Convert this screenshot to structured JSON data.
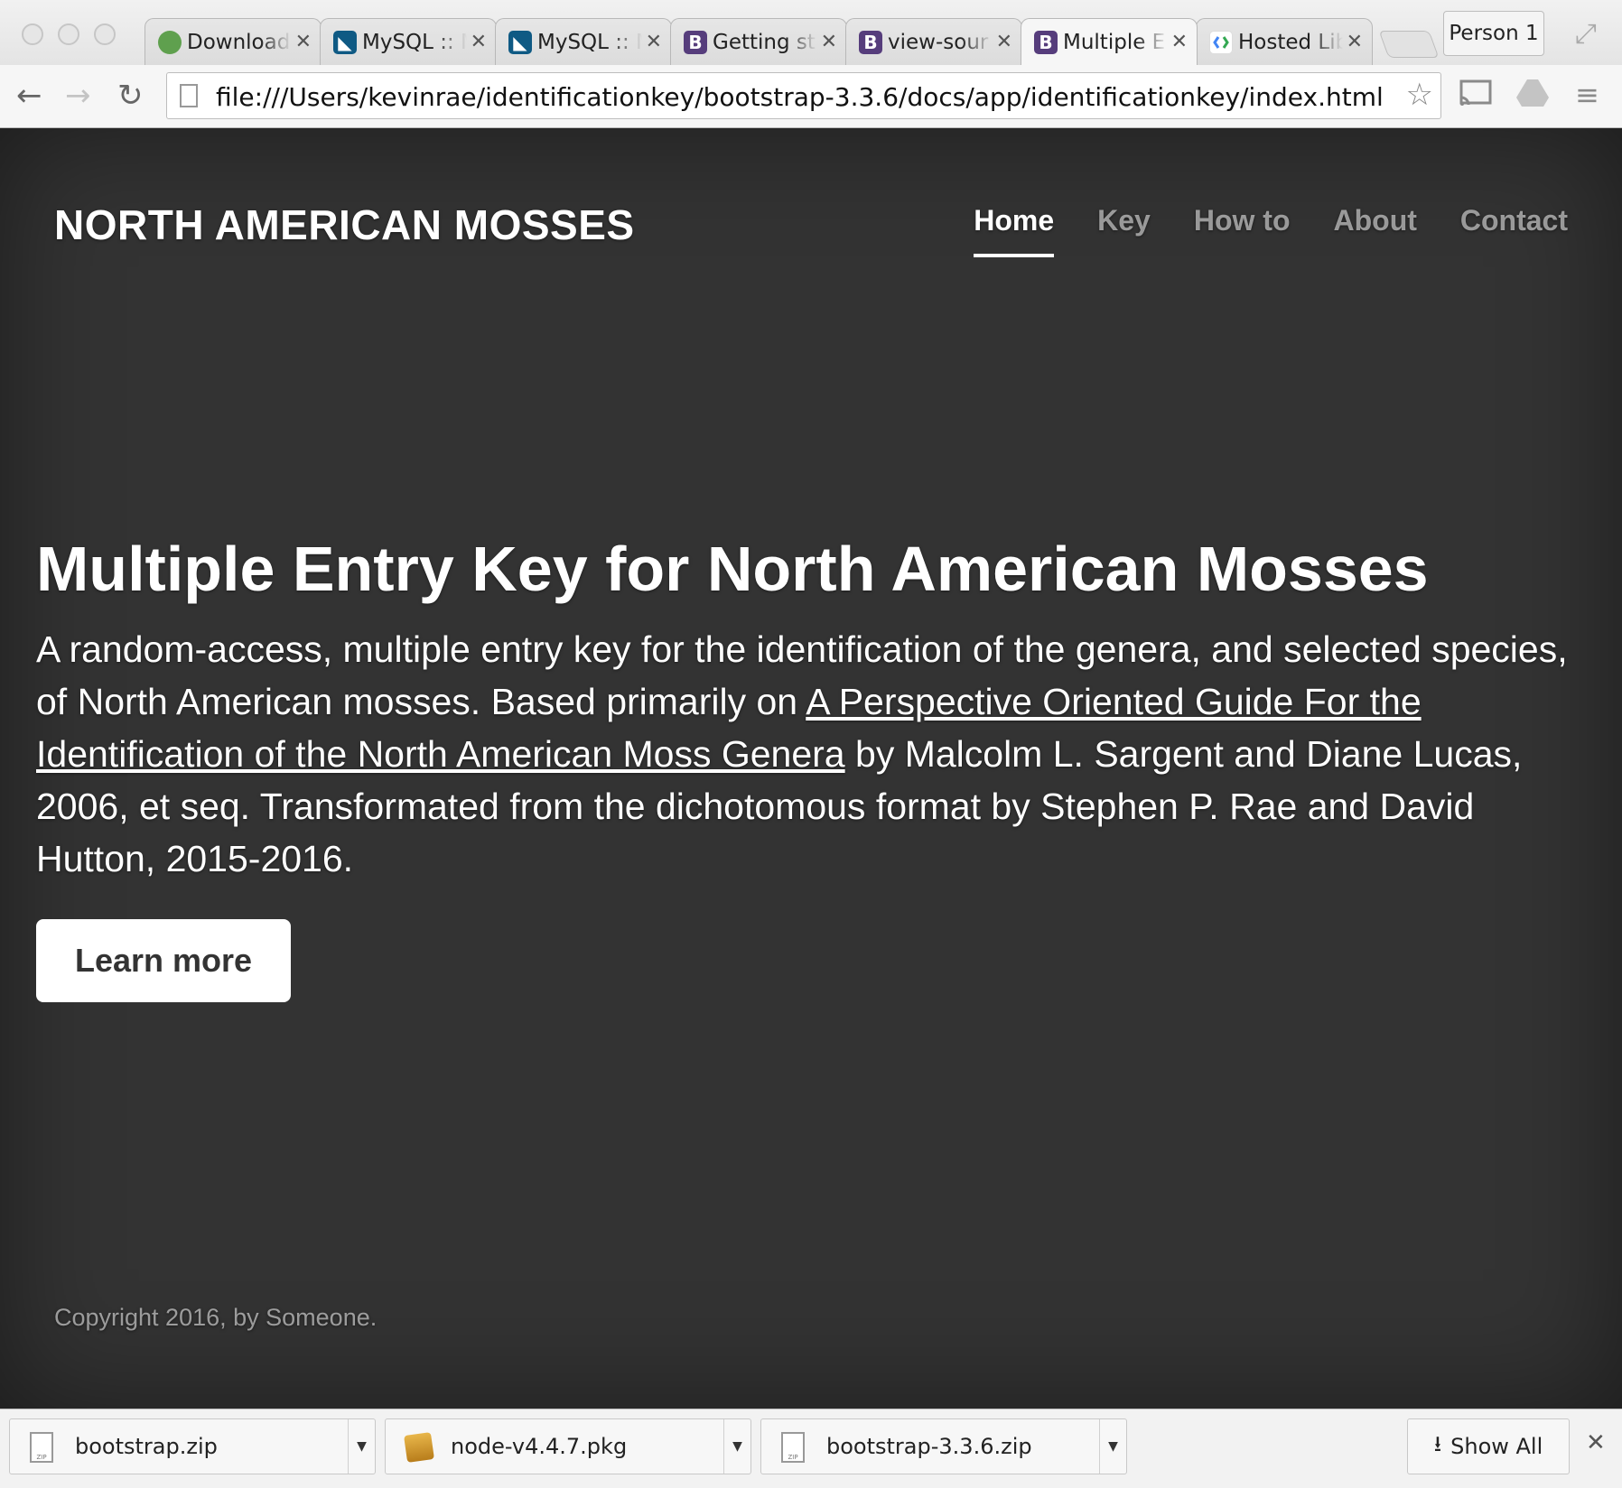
{
  "browser": {
    "tabs": [
      {
        "label": "Download",
        "icon": "node-icon"
      },
      {
        "label": "MySQL :: M",
        "icon": "mysql-icon"
      },
      {
        "label": "MySQL :: M",
        "icon": "mysql-icon"
      },
      {
        "label": "Getting st",
        "icon": "bootstrap-icon"
      },
      {
        "label": "view-sour",
        "icon": "bootstrap-icon"
      },
      {
        "label": "Multiple E",
        "icon": "bootstrap-icon",
        "active": true
      },
      {
        "label": "Hosted Lib",
        "icon": "google-icon"
      }
    ],
    "profile": "Person 1",
    "url": "file:///Users/kevinrae/identificationkey/bootstrap-3.3.6/docs/app/identificationkey/index.html"
  },
  "site": {
    "brand": "NORTH AMERICAN MOSSES",
    "nav": [
      {
        "label": "Home",
        "active": true
      },
      {
        "label": "Key"
      },
      {
        "label": "How to"
      },
      {
        "label": "About"
      },
      {
        "label": "Contact"
      }
    ]
  },
  "hero": {
    "title": "Multiple Entry Key for North American Mosses",
    "lead_before": "A random-access, multiple entry key for the identification of the genera, and selected species, of North American mosses. Based primarily on ",
    "lead_link": "A Perspective Oriented Guide For the Identification of the North American Moss Genera",
    "lead_after": " by Malcolm L. Sargent and Diane Lucas, 2006, et seq. Transformated from the dichotomous format by Stephen P. Rae and David Hutton, 2015-2016.",
    "button": "Learn more"
  },
  "footer": {
    "text": "Copyright 2016, by Someone."
  },
  "downloads": {
    "items": [
      {
        "name": "bootstrap.zip",
        "icon": "zip-file-icon"
      },
      {
        "name": "node-v4.4.7.pkg",
        "icon": "package-icon"
      },
      {
        "name": "bootstrap-3.3.6.zip",
        "icon": "zip-file-icon"
      }
    ],
    "show_all": "Show All"
  },
  "colors": {
    "page_bg": "#333333",
    "text": "#ffffff",
    "nav_inactive": "rgba(255,255,255,0.55)"
  }
}
